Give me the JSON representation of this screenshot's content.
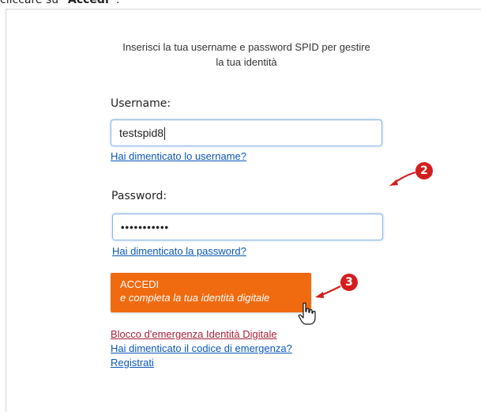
{
  "doc_top_text": {
    "prefix": "cliccare su ",
    "bold": "“Accedi”",
    "suffix": "."
  },
  "login": {
    "instructions": "Inserisci la tua username e password SPID per gestire la tua identità",
    "username_label": "Username:",
    "username_value": "testspid8",
    "forgot_username": "Hai dimenticato lo username?",
    "password_label": "Password:",
    "password_masked": "•••••••••••",
    "forgot_password": "Hai dimenticato la password?",
    "accedi_title": "ACCEDI",
    "accedi_subtitle": "e completa la tua identità digitale",
    "emergency_block": "Blocco d'emergenza Identità Digitale",
    "forgot_emergency_code": "Hai dimenticato il codice di emergenza?",
    "register": "Registrati"
  },
  "annotations": {
    "marker_2": "2",
    "marker_3": "3"
  },
  "colors": {
    "accent_orange": "#f06a10",
    "link_blue": "#0b57b8",
    "link_maroon": "#a3233b",
    "marker_red": "#d41e1e"
  },
  "icons": {
    "pointer": "hand-pointer-cursor-icon",
    "arrow": "red-annotation-arrow-icon"
  }
}
